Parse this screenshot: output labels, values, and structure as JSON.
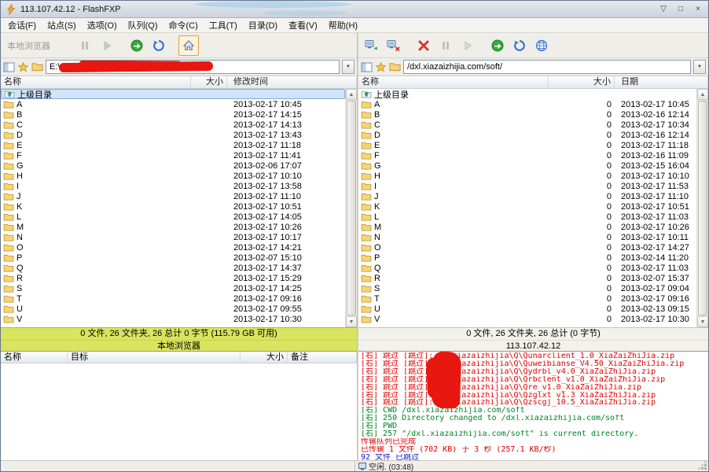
{
  "window": {
    "title": "113.107.42.12 - FlashFXP",
    "minimize_glyph": "▽",
    "maximize_glyph": "□",
    "close_glyph": "×"
  },
  "menu": {
    "items": [
      "会话(F)",
      "站点(S)",
      "选项(O)",
      "队列(Q)",
      "命令(C)",
      "工具(T)",
      "目录(D)",
      "查看(V)",
      "帮助(H)"
    ]
  },
  "icons": {
    "scroll_up": "▲",
    "scroll_down": "▼",
    "dropdown": "▼"
  },
  "local_panel": {
    "toolbar_label": "本地浏览器",
    "path": "E:\\",
    "columns": {
      "name": "名称",
      "size": "大小",
      "time": "修改时间"
    },
    "parent_label": "上级目录",
    "files": [
      {
        "name": "A",
        "size": "",
        "time": "2013-02-17 10:45"
      },
      {
        "name": "B",
        "size": "",
        "time": "2013-02-17 14:15"
      },
      {
        "name": "C",
        "size": "",
        "time": "2013-02-17 14:13"
      },
      {
        "name": "D",
        "size": "",
        "time": "2013-02-17 13:43"
      },
      {
        "name": "E",
        "size": "",
        "time": "2013-02-17 11:18"
      },
      {
        "name": "F",
        "size": "",
        "time": "2013-02-17 11:41"
      },
      {
        "name": "G",
        "size": "",
        "time": "2013-02-06 17:07"
      },
      {
        "name": "H",
        "size": "",
        "time": "2013-02-17 10:10"
      },
      {
        "name": "I",
        "size": "",
        "time": "2013-02-17 13:58"
      },
      {
        "name": "J",
        "size": "",
        "time": "2013-02-17 11:10"
      },
      {
        "name": "K",
        "size": "",
        "time": "2013-02-17 10:51"
      },
      {
        "name": "L",
        "size": "",
        "time": "2013-02-17 14:05"
      },
      {
        "name": "M",
        "size": "",
        "time": "2013-02-17 10:26"
      },
      {
        "name": "N",
        "size": "",
        "time": "2013-02-17 10:17"
      },
      {
        "name": "O",
        "size": "",
        "time": "2013-02-17 14:21"
      },
      {
        "name": "P",
        "size": "",
        "time": "2013-02-07 15:10"
      },
      {
        "name": "Q",
        "size": "",
        "time": "2013-02-17 14:37"
      },
      {
        "name": "R",
        "size": "",
        "time": "2013-02-17 15:29"
      },
      {
        "name": "S",
        "size": "",
        "time": "2013-02-17 14:25"
      },
      {
        "name": "T",
        "size": "",
        "time": "2013-02-17 09:16"
      },
      {
        "name": "U",
        "size": "",
        "time": "2013-02-17 09:55"
      },
      {
        "name": "V",
        "size": "",
        "time": "2013-02-17 10:30"
      }
    ],
    "status_line1": "0 文件, 26 文件夹, 26 总计 0 字节 (115.79 GB 可用)",
    "status_line2": "本地浏览器"
  },
  "remote_panel": {
    "path": "/dxl.xiazaizhijia.com/soft/",
    "columns": {
      "name": "名称",
      "size": "大小",
      "time": "日期"
    },
    "parent_label": "上级目录",
    "files": [
      {
        "name": "A",
        "size": "0",
        "time": "2013-02-17 10:45"
      },
      {
        "name": "B",
        "size": "0",
        "time": "2013-02-16 12:14"
      },
      {
        "name": "C",
        "size": "0",
        "time": "2013-02-17 10:34"
      },
      {
        "name": "D",
        "size": "0",
        "time": "2013-02-16 12:14"
      },
      {
        "name": "E",
        "size": "0",
        "time": "2013-02-17 11:18"
      },
      {
        "name": "F",
        "size": "0",
        "time": "2013-02-16 11:09"
      },
      {
        "name": "G",
        "size": "0",
        "time": "2013-02-15 16:04"
      },
      {
        "name": "H",
        "size": "0",
        "time": "2013-02-17 10:10"
      },
      {
        "name": "I",
        "size": "0",
        "time": "2013-02-17 11:53"
      },
      {
        "name": "J",
        "size": "0",
        "time": "2013-02-17 11:10"
      },
      {
        "name": "K",
        "size": "0",
        "time": "2013-02-17 10:51"
      },
      {
        "name": "L",
        "size": "0",
        "time": "2013-02-17 11:03"
      },
      {
        "name": "M",
        "size": "0",
        "time": "2013-02-17 10:26"
      },
      {
        "name": "N",
        "size": "0",
        "time": "2013-02-17 10:11"
      },
      {
        "name": "O",
        "size": "0",
        "time": "2013-02-17 14:27"
      },
      {
        "name": "P",
        "size": "0",
        "time": "2013-02-14 11:20"
      },
      {
        "name": "Q",
        "size": "0",
        "time": "2013-02-17 11:03"
      },
      {
        "name": "R",
        "size": "0",
        "time": "2013-02-07 15:37"
      },
      {
        "name": "S",
        "size": "0",
        "time": "2013-02-17 09:04"
      },
      {
        "name": "T",
        "size": "0",
        "time": "2013-02-17 09:16"
      },
      {
        "name": "U",
        "size": "0",
        "time": "2013-02-13 09:15"
      },
      {
        "name": "V",
        "size": "0",
        "time": "2013-02-17 10:30"
      }
    ],
    "status_line1": "0 文件, 26 文件夹, 26 总计 (0 字节)",
    "status_line2": "113.107.42.12"
  },
  "queue_panel": {
    "columns": [
      "名称",
      "目标",
      "大小",
      "备注"
    ]
  },
  "log_panel": {
    "lines": [
      {
        "color": "red",
        "text": "[右] 跳过 [跳过]: E:\\xiazaizhijia\\Q\\Qunarclient_1.0_XiaZaiZhiJia.zip"
      },
      {
        "color": "red",
        "text": "[右] 跳过 [跳过]: E:\\xiazaizhijia\\Q\\Quweibianse_V4.50_XiaZaiZhiJia.zip"
      },
      {
        "color": "red",
        "text": "[右] 跳过 [跳过]: E:\\xiazaizhijia\\Q\\Qydrbl_v4.0_XiaZaiZhiJia.zip"
      },
      {
        "color": "red",
        "text": "[右] 跳过 [跳过]: E:\\xiazaizhijia\\Q\\Qrbclent_v1.0_XiaZaiZhiJia.zip"
      },
      {
        "color": "red",
        "text": "[右] 跳过 [跳过]: E:\\xiazaizhijia\\Q\\Qre_v1.0_XiaZaiZhiJia.zip"
      },
      {
        "color": "red",
        "text": "[右] 跳过 [跳过]: E:\\xiazaizhijia\\Q\\Qzglxt_v1.3_XiaZaiZhiJia.zip"
      },
      {
        "color": "red",
        "text": "[右] 跳过 [跳过]: E:\\xiazaizhijia\\Q\\Qzscgj_10.5_XiaZaiZhiJia.zip"
      },
      {
        "color": "green",
        "text": "[右] CWD /dxl.xiazaizhijia.com/soft"
      },
      {
        "color": "green",
        "text": "[右] 250 Directory changed to /dxl.xiazaizhijia.com/soft"
      },
      {
        "color": "green",
        "text": "[右] PWD"
      },
      {
        "color": "green",
        "text": "[右] 257 \"/dxl.xiazaizhijia.com/soft\" is current directory."
      },
      {
        "color": "red",
        "text": "传输队列已完成"
      },
      {
        "color": "red",
        "text": "已传输 1 文件 (702 KB) 于 3 秒 (257.1 KB/秒)"
      },
      {
        "color": "blue",
        "text": "92 文件 已跳过"
      }
    ]
  },
  "statusbar": {
    "text": "空闲. (03:48)"
  }
}
